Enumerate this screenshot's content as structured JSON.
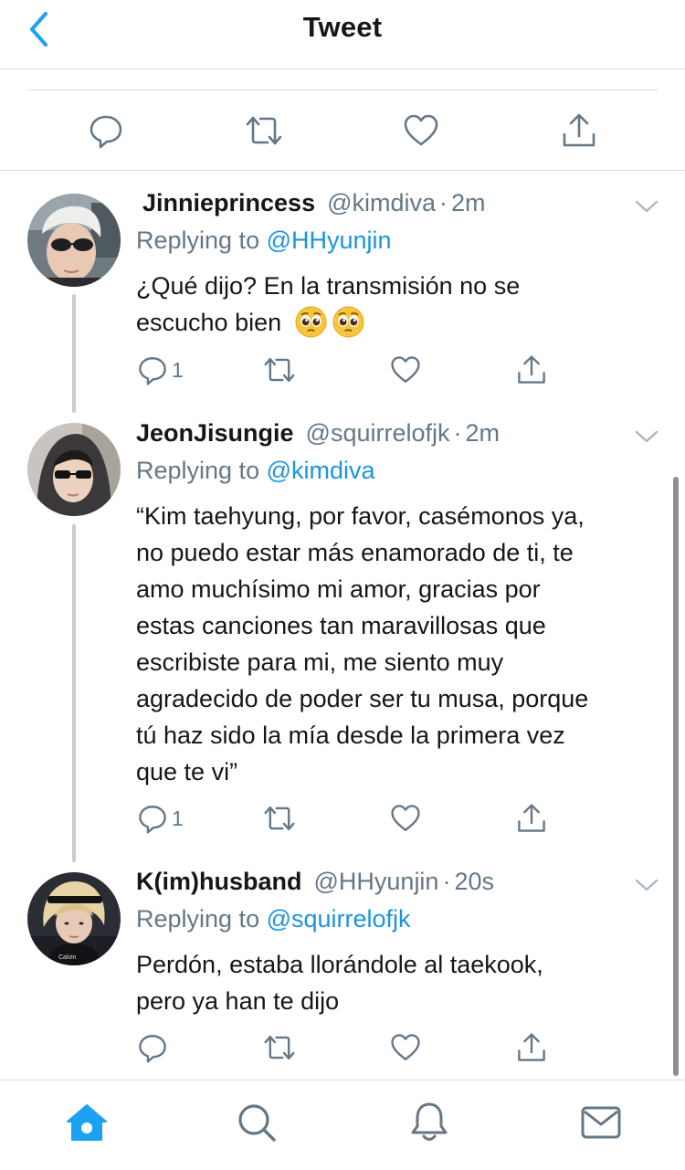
{
  "header": {
    "title": "Tweet",
    "back_icon": "chevron-left-icon"
  },
  "colors": {
    "link": "#1b95e0",
    "secondary": "#657786",
    "icon": "#657786",
    "accent": "#1da1f2"
  },
  "main_actions": [
    "reply-icon",
    "retweet-icon",
    "like-icon",
    "share-icon"
  ],
  "tweets": [
    {
      "name": "Jinnieprincess",
      "handle": "@kimdiva",
      "separator": "·",
      "time": "2m",
      "replying_prefix": "Replying to ",
      "replying_to": "@HHyunjin",
      "text_line1": "¿Qué dijo? En la transmisión no se",
      "text_line2": "escucho bien",
      "emoji": "pleading-face",
      "reply_count": "1"
    },
    {
      "name": "JeonJisungie",
      "handle": "@squirrelofjk",
      "separator": "·",
      "time": "2m",
      "replying_prefix": "Replying to ",
      "replying_to": "@kimdiva",
      "text_lines": [
        "“Kim taehyung, por favor, casémonos ya,",
        "no puedo estar más enamorado de ti, te",
        "amo muchísimo mi amor, gracias por",
        "estas canciones tan maravillosas que",
        "escribiste para mi, me siento muy",
        "agradecido de poder ser tu musa, porque",
        "tú haz sido la mía desde la primera vez",
        "que te vi”"
      ],
      "reply_count": "1"
    },
    {
      "name": "K(im)husband",
      "handle": "@HHyunjin",
      "separator": "·",
      "time": "20s",
      "replying_prefix": "Replying to ",
      "replying_to": "@squirrelofjk",
      "text_lines": [
        "Perdón, estaba llorándole al taekook,",
        "pero ya han te dijo"
      ],
      "reply_count": ""
    }
  ],
  "tabbar": [
    "home-icon",
    "search-icon",
    "notifications-icon",
    "messages-icon"
  ]
}
